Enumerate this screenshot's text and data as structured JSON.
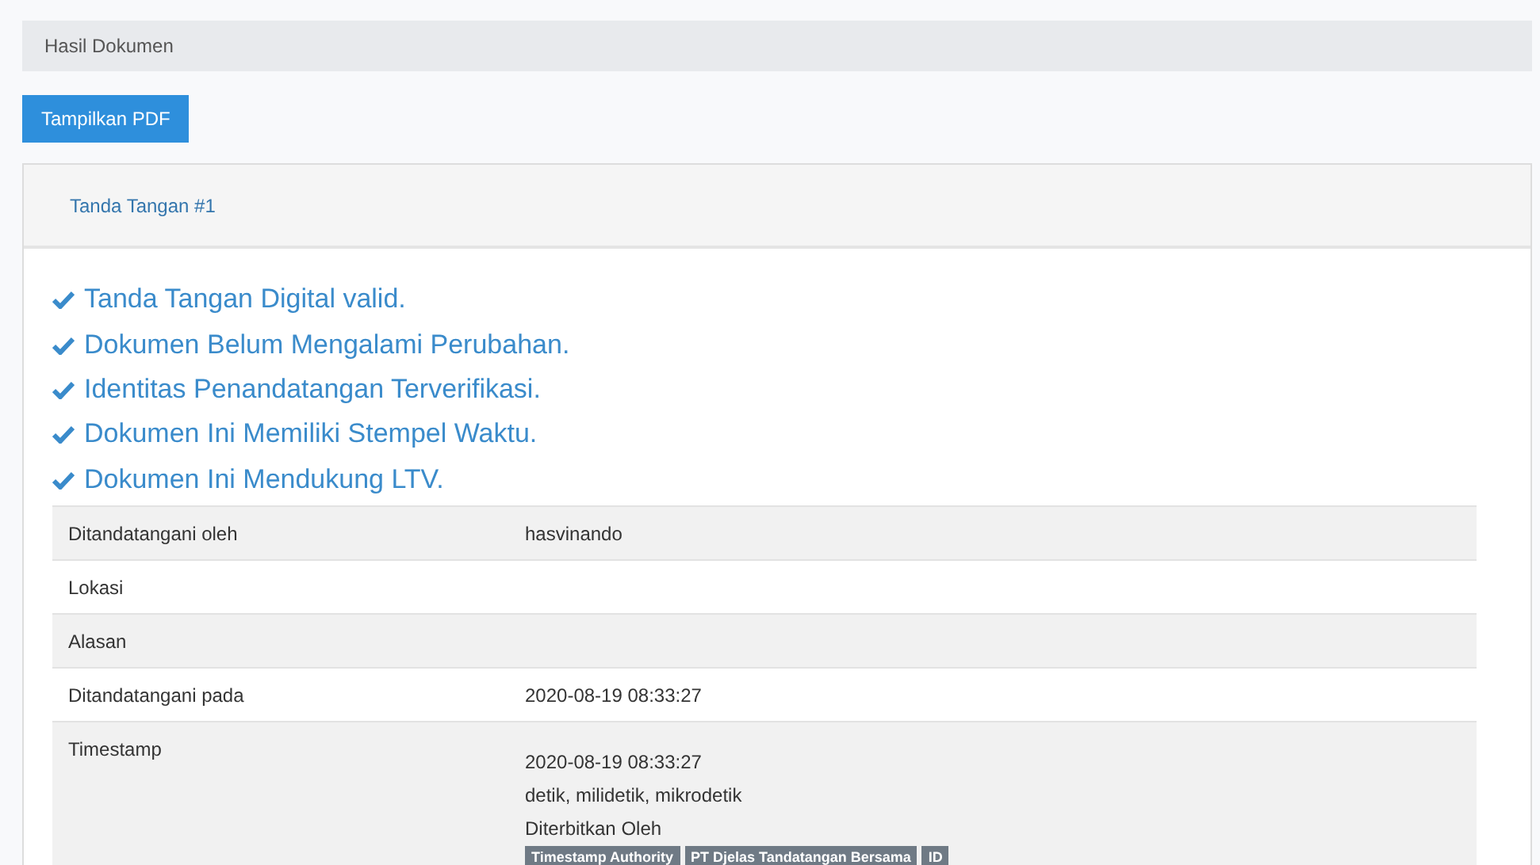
{
  "breadcrumb": "Hasil Dokumen",
  "button": "Tampilkan PDF",
  "panel": {
    "title": "Tanda Tangan #1",
    "checks": [
      "Tanda Tangan Digital valid.",
      "Dokumen Belum Mengalami Perubahan.",
      "Identitas Penandatangan Terverifikasi.",
      "Dokumen Ini Memiliki Stempel Waktu.",
      "Dokumen Ini Mendukung LTV."
    ],
    "rows": [
      {
        "label": "Ditandatangani oleh",
        "lines": [
          "hasvinando"
        ]
      },
      {
        "label": "Lokasi",
        "lines": []
      },
      {
        "label": "Alasan",
        "lines": []
      },
      {
        "label": "Ditandatangani pada",
        "lines": [
          "2020-08-19 08:33:27"
        ]
      },
      {
        "label": "Timestamp",
        "lines": [
          "2020-08-19 08:33:27",
          "detik, milidetik, mikrodetik",
          "Diterbitkan Oleh"
        ],
        "tags": [
          "Timestamp Authority",
          "PT Djelas Tandatangan Bersama",
          "ID"
        ]
      }
    ]
  }
}
